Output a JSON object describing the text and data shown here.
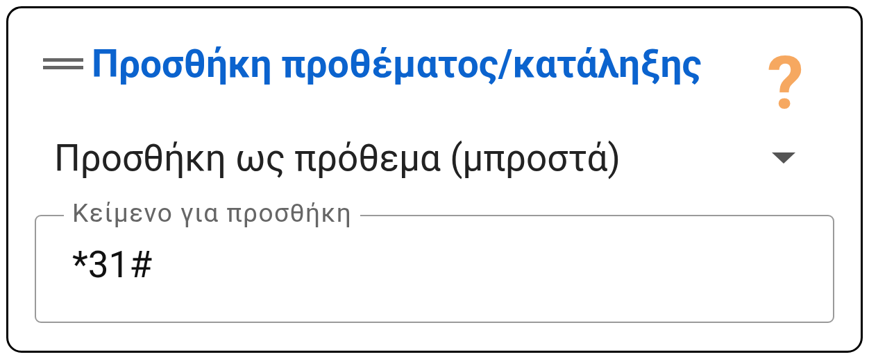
{
  "card": {
    "title": "Προσθήκη προθέματος/κατάληξης",
    "help": "?",
    "dropdown": {
      "value": "Προσθήκη ως πρόθεμα (μπροστά)"
    },
    "field": {
      "label": "Κείμενο για προσθήκη",
      "value": "*31#"
    }
  }
}
